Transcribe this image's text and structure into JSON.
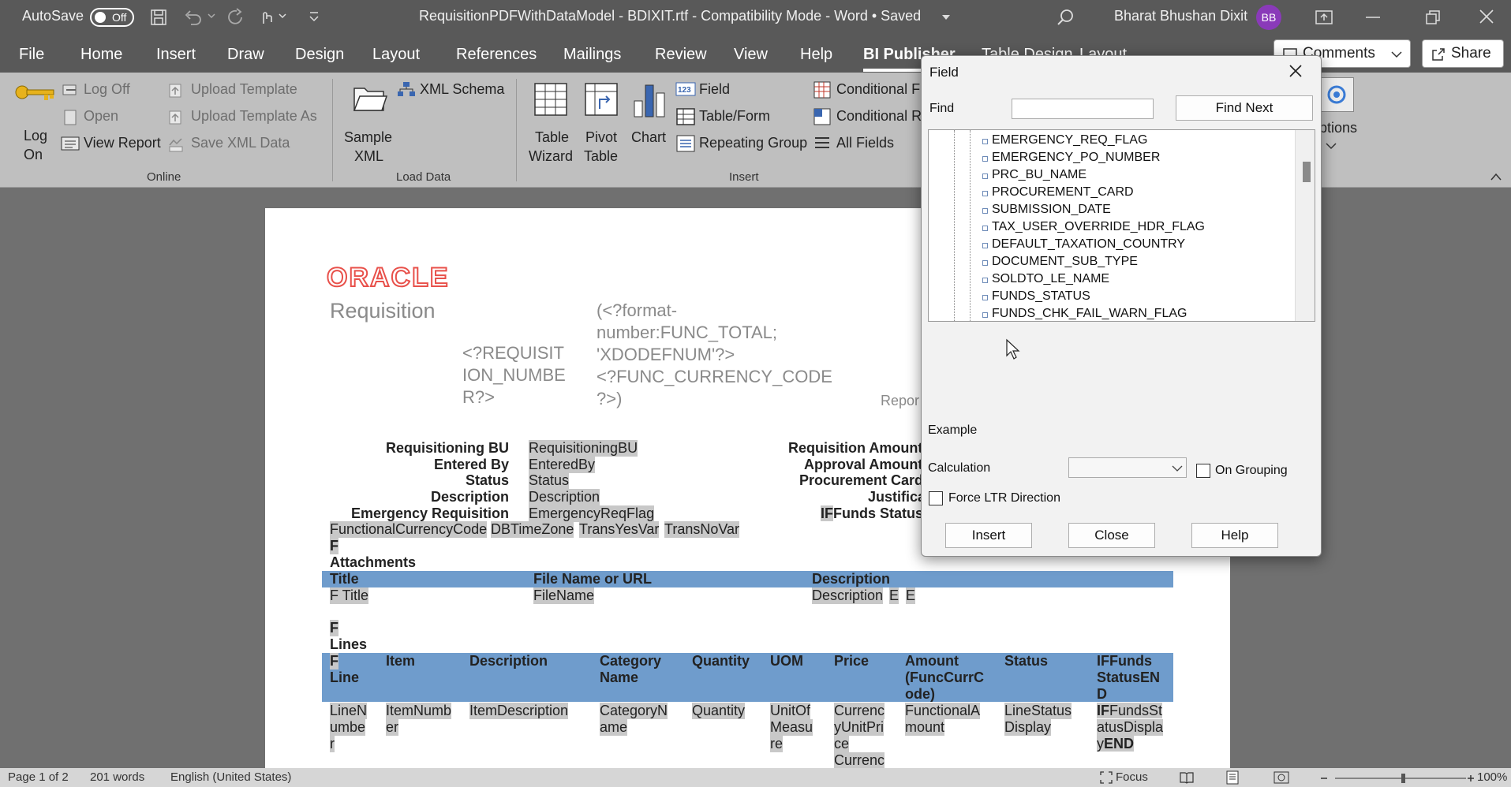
{
  "titlebar": {
    "autosave": "AutoSave",
    "autosave_state": "Off",
    "doc_title": "RequisitionPDFWithDataModel - BDIXIT.rtf  -  Compatibility Mode  -  Word • Saved",
    "user_name": "Bharat Bhushan Dixit",
    "user_initials": "BB"
  },
  "tabs": [
    "File",
    "Home",
    "Insert",
    "Draw",
    "Design",
    "Layout",
    "References",
    "Mailings",
    "Review",
    "View",
    "Help",
    "BI Publisher",
    "Table Design",
    "Layout"
  ],
  "header_buttons": {
    "comments": "Comments",
    "share": "Share"
  },
  "ribbon": {
    "online": {
      "group": "Online",
      "log_on_1": "Log",
      "log_on_2": "On",
      "log_off": "Log Off",
      "open": "Open",
      "view_report": "View Report",
      "upload_template": "Upload Template",
      "upload_template_as": "Upload Template As",
      "save_xml_data": "Save XML Data"
    },
    "load_data": {
      "group": "Load Data",
      "sample_xml_1": "Sample",
      "sample_xml_2": "XML",
      "xml_schema": "XML Schema"
    },
    "insert": {
      "group": "Insert",
      "table_wizard_1": "Table",
      "table_wizard_2": "Wizard",
      "pivot_table_1": "Pivot",
      "pivot_table_2": "Table",
      "chart": "Chart",
      "field": "Field",
      "table_form": "Table/Form",
      "repeating_group": "Repeating Group",
      "conditional_1": "Conditional F",
      "conditional_2": "Conditional R",
      "all_fields": "All Fields"
    },
    "options_1": "ptions"
  },
  "document": {
    "logo": "ORACLE",
    "title": "Requisition",
    "req_number": [
      "<?REQUISIT",
      "ION_NUMBE",
      "R?>"
    ],
    "format_number": [
      "(<?format-",
      "number:FUNC_TOTAL;",
      "'XDODEFNUM'?>",
      "<?FUNC_CURRENCY_CODE",
      "?>)"
    ],
    "report_label": "Repor",
    "left_labels": [
      "Requisitioning BU",
      "Entered By",
      "Status",
      "Description",
      "Emergency Requisition"
    ],
    "left_values": [
      "RequisitioningBU",
      "EnteredBy",
      "Status",
      "Description",
      "EmergencyReqFlag"
    ],
    "right_labels": [
      "Requisition Amount",
      "Approval Amount",
      "Procurement Card",
      "Justification",
      "Funds Status"
    ],
    "right_if": "IF",
    "fields_row": [
      "FunctionalCurrencyCode",
      "DBTimeZone",
      "TransYesVar",
      "TransNoVar"
    ],
    "f_marker": "F",
    "attachments_title": "Attachments",
    "attachments_headers": [
      "Title",
      "File Name or URL",
      "Description"
    ],
    "attachments_row": {
      "title": "F Title",
      "file": "FileName",
      "desc": "Description",
      "e1": "E",
      "e2": "E"
    },
    "lines_title": "Lines",
    "lines_headers": {
      "f": "F",
      "line": "Line",
      "item": "Item",
      "description": "Description",
      "category": [
        "Category",
        "Name"
      ],
      "quantity": "Quantity",
      "uom": "UOM",
      "price": "Price",
      "amount": [
        "Amount",
        "(FuncCurrC",
        "ode)"
      ],
      "status": "Status",
      "funds": [
        "IFFunds",
        "StatusEN",
        "D"
      ]
    },
    "lines_row": {
      "line": [
        "LineN",
        "umbe",
        "r"
      ],
      "item": [
        "ItemNumb",
        "er"
      ],
      "description": "ItemDescription",
      "category": [
        "CategoryN",
        "ame"
      ],
      "quantity": "Quantity",
      "uom": [
        "UnitOf",
        "Measu",
        "re"
      ],
      "price": [
        "Currenc",
        "yUnitPri",
        "ce",
        "Currenc"
      ],
      "amount": [
        "FunctionalA",
        "mount"
      ],
      "status": [
        "LineStatus",
        "Display"
      ],
      "funds_if": "IF",
      "funds": [
        "FundsSt",
        "atusDispla",
        "y"
      ],
      "funds_end": "END"
    }
  },
  "dialog": {
    "title": "Field",
    "find_label": "Find",
    "find_value": "",
    "find_next": "Find Next",
    "tree_items": [
      "EMERGENCY_REQ_FLAG",
      "EMERGENCY_PO_NUMBER",
      "PRC_BU_NAME",
      "PROCUREMENT_CARD",
      "SUBMISSION_DATE",
      "TAX_USER_OVERRIDE_HDR_FLAG",
      "DEFAULT_TAXATION_COUNTRY",
      "DOCUMENT_SUB_TYPE",
      "SOLDTO_LE_NAME",
      "FUNDS_STATUS",
      "FUNDS_CHK_FAIL_WARN_FLAG"
    ],
    "example_label": "Example",
    "calculation_label": "Calculation",
    "calculation_value": "",
    "on_grouping": "On Grouping",
    "force_ltr": "Force LTR Direction",
    "insert": "Insert",
    "close": "Close",
    "help": "Help"
  },
  "statusbar": {
    "page": "Page 1 of 2",
    "words": "201 words",
    "language": "English (United States)",
    "focus": "Focus",
    "zoom": "100%"
  },
  "colors": {
    "titlebar": "#595959",
    "ribbon": "#bfbfbf",
    "table_header": "#6f9ccc",
    "oracle_red": "#e8504a",
    "avatar": "#8a3ab9"
  }
}
